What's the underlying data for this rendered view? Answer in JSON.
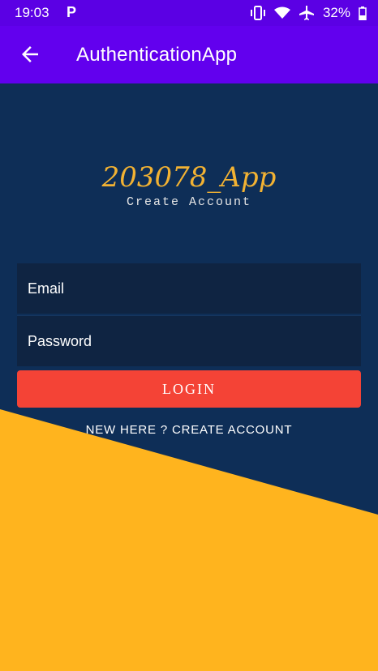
{
  "status_bar": {
    "time": "19:03",
    "notification_icon": "P",
    "battery_percent": "32%",
    "icons": [
      "vibrate-icon",
      "wifi-icon",
      "airplane-icon",
      "battery-icon"
    ]
  },
  "app_bar": {
    "title": "AuthenticationApp",
    "back_icon": "arrow-back-icon"
  },
  "branding": {
    "logo_text": "203078_App",
    "subtitle": "Create Account"
  },
  "form": {
    "email_placeholder": "Email",
    "password_placeholder": "Password",
    "login_button_label": "LOGIN",
    "signup_link": "NEW HERE ? CREATE ACCOUNT"
  },
  "colors": {
    "status_bar": "#5b00e4",
    "app_bar": "#6200ee",
    "background_navy": "#0e2e57",
    "accent_yellow": "#ffb41e",
    "button_red": "#f44336"
  }
}
